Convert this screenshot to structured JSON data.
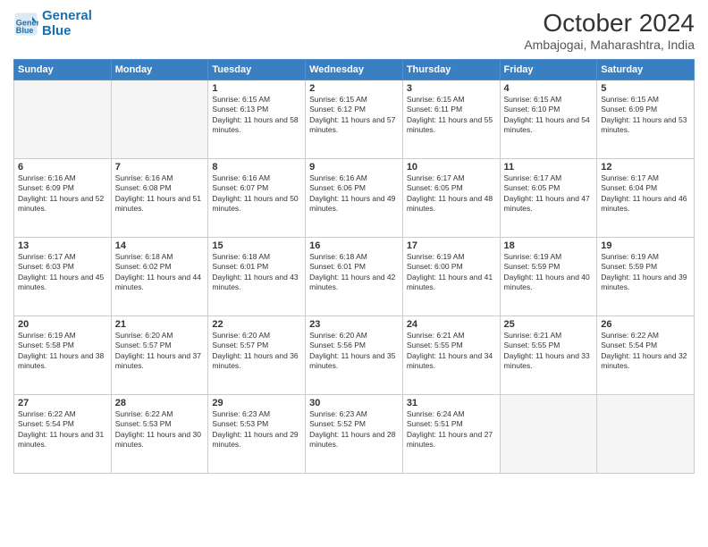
{
  "logo": {
    "line1": "General",
    "line2": "Blue"
  },
  "title": "October 2024",
  "subtitle": "Ambajogai, Maharashtra, India",
  "weekdays": [
    "Sunday",
    "Monday",
    "Tuesday",
    "Wednesday",
    "Thursday",
    "Friday",
    "Saturday"
  ],
  "weeks": [
    [
      {
        "day": "",
        "info": ""
      },
      {
        "day": "",
        "info": ""
      },
      {
        "day": "1",
        "info": "Sunrise: 6:15 AM\nSunset: 6:13 PM\nDaylight: 11 hours and 58 minutes."
      },
      {
        "day": "2",
        "info": "Sunrise: 6:15 AM\nSunset: 6:12 PM\nDaylight: 11 hours and 57 minutes."
      },
      {
        "day": "3",
        "info": "Sunrise: 6:15 AM\nSunset: 6:11 PM\nDaylight: 11 hours and 55 minutes."
      },
      {
        "day": "4",
        "info": "Sunrise: 6:15 AM\nSunset: 6:10 PM\nDaylight: 11 hours and 54 minutes."
      },
      {
        "day": "5",
        "info": "Sunrise: 6:15 AM\nSunset: 6:09 PM\nDaylight: 11 hours and 53 minutes."
      }
    ],
    [
      {
        "day": "6",
        "info": "Sunrise: 6:16 AM\nSunset: 6:09 PM\nDaylight: 11 hours and 52 minutes."
      },
      {
        "day": "7",
        "info": "Sunrise: 6:16 AM\nSunset: 6:08 PM\nDaylight: 11 hours and 51 minutes."
      },
      {
        "day": "8",
        "info": "Sunrise: 6:16 AM\nSunset: 6:07 PM\nDaylight: 11 hours and 50 minutes."
      },
      {
        "day": "9",
        "info": "Sunrise: 6:16 AM\nSunset: 6:06 PM\nDaylight: 11 hours and 49 minutes."
      },
      {
        "day": "10",
        "info": "Sunrise: 6:17 AM\nSunset: 6:05 PM\nDaylight: 11 hours and 48 minutes."
      },
      {
        "day": "11",
        "info": "Sunrise: 6:17 AM\nSunset: 6:05 PM\nDaylight: 11 hours and 47 minutes."
      },
      {
        "day": "12",
        "info": "Sunrise: 6:17 AM\nSunset: 6:04 PM\nDaylight: 11 hours and 46 minutes."
      }
    ],
    [
      {
        "day": "13",
        "info": "Sunrise: 6:17 AM\nSunset: 6:03 PM\nDaylight: 11 hours and 45 minutes."
      },
      {
        "day": "14",
        "info": "Sunrise: 6:18 AM\nSunset: 6:02 PM\nDaylight: 11 hours and 44 minutes."
      },
      {
        "day": "15",
        "info": "Sunrise: 6:18 AM\nSunset: 6:01 PM\nDaylight: 11 hours and 43 minutes."
      },
      {
        "day": "16",
        "info": "Sunrise: 6:18 AM\nSunset: 6:01 PM\nDaylight: 11 hours and 42 minutes."
      },
      {
        "day": "17",
        "info": "Sunrise: 6:19 AM\nSunset: 6:00 PM\nDaylight: 11 hours and 41 minutes."
      },
      {
        "day": "18",
        "info": "Sunrise: 6:19 AM\nSunset: 5:59 PM\nDaylight: 11 hours and 40 minutes."
      },
      {
        "day": "19",
        "info": "Sunrise: 6:19 AM\nSunset: 5:59 PM\nDaylight: 11 hours and 39 minutes."
      }
    ],
    [
      {
        "day": "20",
        "info": "Sunrise: 6:19 AM\nSunset: 5:58 PM\nDaylight: 11 hours and 38 minutes."
      },
      {
        "day": "21",
        "info": "Sunrise: 6:20 AM\nSunset: 5:57 PM\nDaylight: 11 hours and 37 minutes."
      },
      {
        "day": "22",
        "info": "Sunrise: 6:20 AM\nSunset: 5:57 PM\nDaylight: 11 hours and 36 minutes."
      },
      {
        "day": "23",
        "info": "Sunrise: 6:20 AM\nSunset: 5:56 PM\nDaylight: 11 hours and 35 minutes."
      },
      {
        "day": "24",
        "info": "Sunrise: 6:21 AM\nSunset: 5:55 PM\nDaylight: 11 hours and 34 minutes."
      },
      {
        "day": "25",
        "info": "Sunrise: 6:21 AM\nSunset: 5:55 PM\nDaylight: 11 hours and 33 minutes."
      },
      {
        "day": "26",
        "info": "Sunrise: 6:22 AM\nSunset: 5:54 PM\nDaylight: 11 hours and 32 minutes."
      }
    ],
    [
      {
        "day": "27",
        "info": "Sunrise: 6:22 AM\nSunset: 5:54 PM\nDaylight: 11 hours and 31 minutes."
      },
      {
        "day": "28",
        "info": "Sunrise: 6:22 AM\nSunset: 5:53 PM\nDaylight: 11 hours and 30 minutes."
      },
      {
        "day": "29",
        "info": "Sunrise: 6:23 AM\nSunset: 5:53 PM\nDaylight: 11 hours and 29 minutes."
      },
      {
        "day": "30",
        "info": "Sunrise: 6:23 AM\nSunset: 5:52 PM\nDaylight: 11 hours and 28 minutes."
      },
      {
        "day": "31",
        "info": "Sunrise: 6:24 AM\nSunset: 5:51 PM\nDaylight: 11 hours and 27 minutes."
      },
      {
        "day": "",
        "info": ""
      },
      {
        "day": "",
        "info": ""
      }
    ]
  ]
}
